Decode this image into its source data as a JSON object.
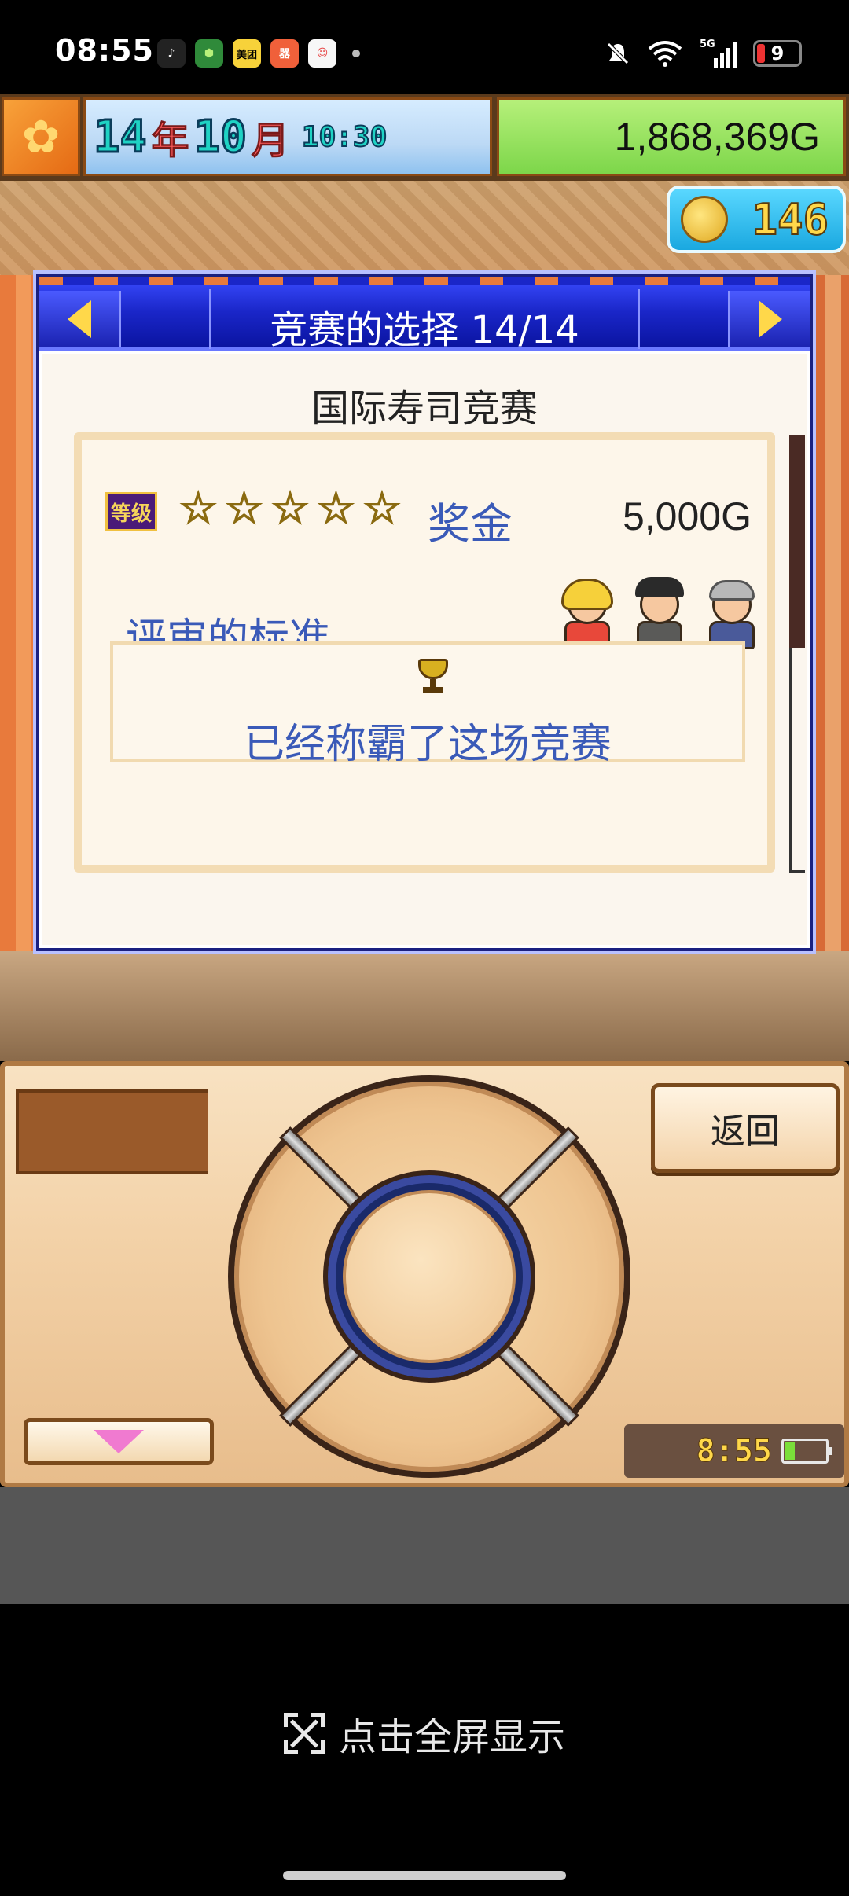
{
  "status_bar": {
    "time": "08:55",
    "apps": [
      {
        "name": "tiktok-icon",
        "glyph": "♪",
        "color": "#111111"
      },
      {
        "name": "app-green-icon",
        "glyph": "⬢",
        "color": "#2f8a3a"
      },
      {
        "name": "meituan-icon",
        "glyph": "美团",
        "color": "#f7d23a"
      },
      {
        "name": "app-orange-icon",
        "glyph": "器",
        "color": "#f0603a"
      },
      {
        "name": "app-mascot-icon",
        "glyph": "☺",
        "color": "#e84a4a"
      }
    ],
    "network": "5G",
    "battery": "9"
  },
  "game": {
    "date": {
      "year": "14",
      "year_unit": "年",
      "month": "10",
      "month_unit": "月",
      "time": "10:30"
    },
    "money": "1,868,369G",
    "coins": "146"
  },
  "dialog": {
    "title": "竞赛的选择 14/14",
    "contest_name": "国际寿司竞赛",
    "rank_badge": "等级",
    "stars": [
      "☆",
      "☆",
      "☆",
      "☆",
      "☆"
    ],
    "rank_stars": 5,
    "prize_label": "奖金",
    "prize_value": "5,000G",
    "judge_label": "评审的标准",
    "result_text": "已经称霸了这场竞赛"
  },
  "controller": {
    "back_label": "返回",
    "clock": "8:55"
  },
  "footer": {
    "fullscreen_label": "点击全屏显示"
  },
  "colors": {
    "dialog_header": "#1a26c8",
    "accent_blue_text": "#3a5ab8",
    "money_bg": "#7dd64a",
    "coin_bg": "#1aa8e0"
  }
}
